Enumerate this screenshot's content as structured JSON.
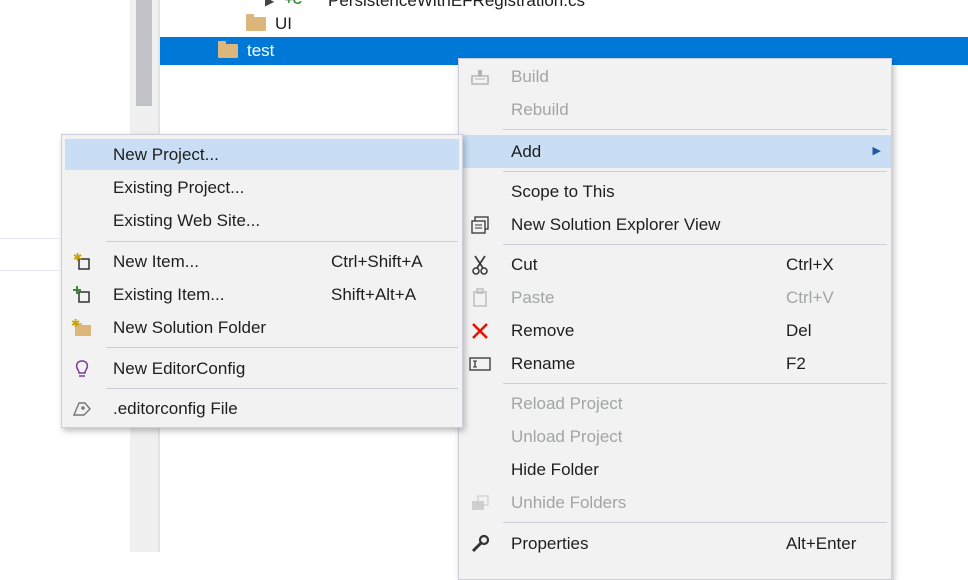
{
  "tree": {
    "partial_file": "PersistenceWithEFRegistration.cs",
    "ui_folder": "UI",
    "selected_folder": "test"
  },
  "context_menu": {
    "build": "Build",
    "rebuild": "Rebuild",
    "add": "Add",
    "scope_to_this": "Scope to This",
    "new_view": "New Solution Explorer View",
    "cut": "Cut",
    "cut_shortcut": "Ctrl+X",
    "paste": "Paste",
    "paste_shortcut": "Ctrl+V",
    "remove": "Remove",
    "remove_shortcut": "Del",
    "rename": "Rename",
    "rename_shortcut": "F2",
    "reload_project": "Reload Project",
    "unload_project": "Unload Project",
    "hide_folder": "Hide Folder",
    "unhide_folders": "Unhide Folders",
    "properties": "Properties",
    "properties_shortcut": "Alt+Enter"
  },
  "add_submenu": {
    "new_project": "New Project...",
    "existing_project": "Existing Project...",
    "existing_web_site": "Existing Web Site...",
    "new_item": "New Item...",
    "new_item_shortcut": "Ctrl+Shift+A",
    "existing_item": "Existing Item...",
    "existing_item_shortcut": "Shift+Alt+A",
    "new_solution_folder": "New Solution Folder",
    "new_editorconfig": "New EditorConfig",
    "editorconfig_file": ".editorconfig File"
  },
  "icons": {
    "build": "build-icon",
    "new_view": "solution-explorer-view-icon",
    "cut": "scissors-icon",
    "paste": "paste-icon",
    "remove": "remove-x-icon",
    "rename": "rename-icon",
    "unhide": "unhide-folders-icon",
    "properties": "wrench-icon",
    "new_item": "new-item-icon",
    "existing_item": "existing-item-icon",
    "new_solution_folder": "new-solution-folder-icon",
    "new_editorconfig": "lightbulb-icon",
    "editorconfig_file": "editorconfig-file-icon"
  },
  "colors": {
    "selection": "#0078d7",
    "menu_background": "#f2f2f2",
    "menu_highlight": "#c9def5",
    "remove_icon": "#e51400",
    "folder": "#dcb67a"
  }
}
